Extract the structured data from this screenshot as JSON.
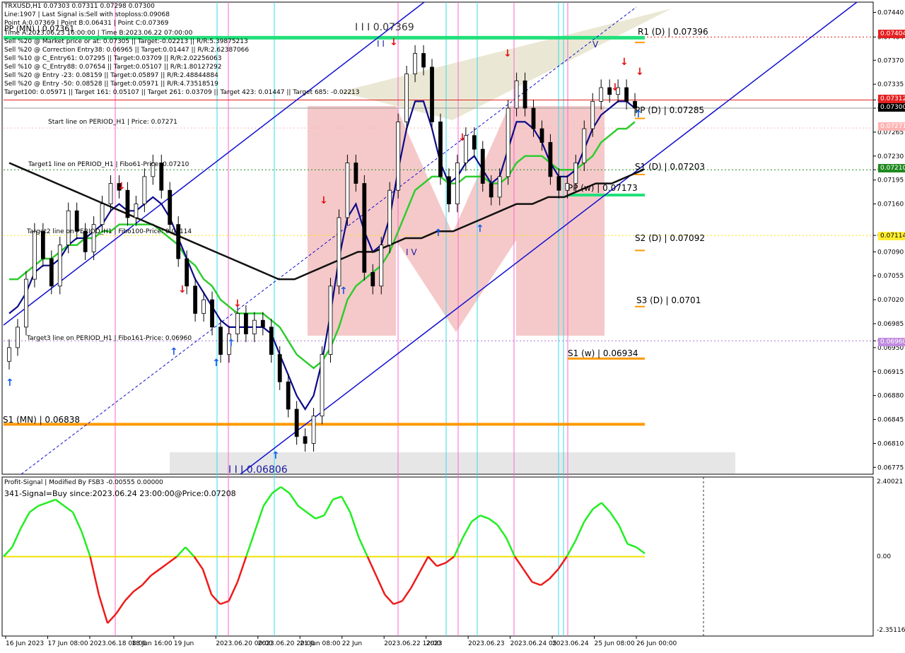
{
  "header": {
    "symbol_line": "TRXUSD,H1  0.07303 0.07311 0.07298 0.07300",
    "line_info": "Line:1907 | Last Signal is:Sell with stoploss:0.09068",
    "point_a": "Point A:0.07369 | Point B:0.06431 | Point C:0.07369",
    "time_a": "Time A:2023.06.23 16:00:00 | Time B:2023.06.22 07:00:00",
    "pp_overlay": "PP (MN) | 0.07361",
    "signals": [
      "Sell %20 @ Market price or at: 0.07305 || Target:-0.02213 || R/R:5.39875213",
      "Sell %20 @ Correction Entry38: 0.06965 || Target:0.01447 || R/R:2.62387066",
      "Sell %10 @ C_Entry61: 0.07295 || Target:0.03709 || R/R:2.02256063",
      "Sell %10 @ C_Entry88: 0.07654 || Target:0.05107 || R/R:1.80127292",
      "Sell %20 @ Entry -23: 0.08159 || Target:0.05897 || R/R:2.48844884",
      "Sell %20 @ Entry -50: 0.08528 || Target:0.05971 || R/R:4.73518519"
    ],
    "targets": "Target100: 0.05971 || Target 161: 0.05107 || Target 261: 0.03709 || Target 423: 0.01447 || Target 685: -0.02213"
  },
  "annotations": {
    "start_line": "Start line on PERIOD_H1 | Price: 0.07271",
    "target1": "Target1 line on PERIOD_H1 | Fibo61-Price: 0.07210",
    "target2": "Target2 line on PERIOD_H1 | Fibo100-Price: 0.07114",
    "target3": "Target3 line on PERIOD_H1 | Fibo161-Price: 0.06960",
    "top_wave": "I I I 0.07369",
    "bottom_wave": "I I I 0.06806",
    "wave_ii": "I I",
    "wave_iv": "I V",
    "wave_v": "V"
  },
  "levels": {
    "r1_d": "R1 (D) | 0.07396",
    "pp_d": "PP (D) | 0.07285",
    "s1_d": "S1 (D) | 0.07203",
    "pp_w": "PP (w) | 0.07173",
    "s2_d": "S2 (D) | 0.07092",
    "s3_d": "S3 (D) | 0.0701",
    "s1_w": "S1 (w) | 0.06934",
    "s1_mn": "S1 (MN) | 0.06838"
  },
  "price_axis": {
    "ticks": [
      "0.07440",
      "0.07404",
      "0.07370",
      "0.07335",
      "0.07312",
      "0.07300",
      "0.07265",
      "0.07230",
      "0.07210",
      "0.07195",
      "0.07160",
      "0.07114",
      "0.07090",
      "0.07055",
      "0.07020",
      "0.06985",
      "0.06960",
      "0.06950",
      "0.06915",
      "0.06880",
      "0.06845",
      "0.06810",
      "0.06775"
    ],
    "tag_red_top": "0.07404",
    "tag_red": "0.07312",
    "tag_black": "0.07300",
    "tag_pink": "0.07271",
    "tag_green": "0.07210",
    "tag_yellow": "0.07114",
    "tag_purple": "0.06960"
  },
  "time_axis": {
    "labels": [
      "16 Jun 2023",
      "17 Jun 08:00",
      "2023.06.18 08:00",
      "18 Jun 16:00",
      "19 Jun",
      "2023.06.20 00:00",
      "2023.06.20 20:00",
      "21 Jun 08:00",
      "22 Jun",
      "2023.06.22 12:00",
      "2023",
      "2023.06.23",
      "2023.06.24 05",
      "2023.06.24",
      "25 Jun 08:00",
      "26 Jun 00:00"
    ]
  },
  "indicator": {
    "title": "Profit-Signal | Modified By FSB3 -0.00555 0.00000",
    "signal": "341-Signal=Buy since:2023.06.24 23:00:00@Price:0.07208",
    "axis_top": "2.40021",
    "axis_zero": "0.00",
    "axis_bottom": "-2.35116"
  },
  "colors": {
    "bull": "#000000",
    "bear": "#000000",
    "ma_fast": "#0b0b8a",
    "ma_mid": "#2ecc2e",
    "ma_slow": "#111111",
    "channel": "#1010d0",
    "orange": "#ff9900",
    "green_level": "#22e07a",
    "pink": "#ff66cc",
    "cyan": "#33ddee"
  },
  "chart_data": {
    "type": "candlestick",
    "title": "TRXUSD,H1",
    "ylim": [
      0.06765,
      0.07455
    ],
    "close_series": [
      0.0695,
      0.0698,
      0.0705,
      0.0712,
      0.0708,
      0.0704,
      0.071,
      0.0715,
      0.0712,
      0.0709,
      0.0713,
      0.0716,
      0.0719,
      0.0718,
      0.0714,
      0.0716,
      0.072,
      0.0722,
      0.0718,
      0.0713,
      0.0708,
      0.0704,
      0.07,
      0.0702,
      0.0698,
      0.0694,
      0.0697,
      0.07,
      0.0697,
      0.0699,
      0.0698,
      0.0694,
      0.069,
      0.0686,
      0.0682,
      0.0681,
      0.0685,
      0.0694,
      0.0704,
      0.0714,
      0.0722,
      0.0719,
      0.0706,
      0.0704,
      0.071,
      0.0718,
      0.0728,
      0.0735,
      0.0738,
      0.0736,
      0.0728,
      0.072,
      0.0716,
      0.0722,
      0.0726,
      0.0724,
      0.0719,
      0.0717,
      0.072,
      0.073,
      0.0734,
      0.073,
      0.0727,
      0.0725,
      0.072,
      0.0718,
      0.0719,
      0.0722,
      0.0727,
      0.0731,
      0.0733,
      0.0732,
      0.0733,
      0.0731,
      0.073
    ],
    "ma_fast": [
      0.07,
      0.0701,
      0.0703,
      0.0706,
      0.0707,
      0.0707,
      0.0708,
      0.071,
      0.0711,
      0.0711,
      0.0712,
      0.0713,
      0.0715,
      0.0716,
      0.0715,
      0.0715,
      0.0716,
      0.0717,
      0.0716,
      0.0714,
      0.0711,
      0.0708,
      0.0705,
      0.0703,
      0.0701,
      0.0699,
      0.0698,
      0.0698,
      0.0698,
      0.0698,
      0.0698,
      0.0697,
      0.0694,
      0.0691,
      0.0688,
      0.0686,
      0.0688,
      0.0693,
      0.07,
      0.0708,
      0.0714,
      0.0716,
      0.0712,
      0.0709,
      0.071,
      0.0714,
      0.0721,
      0.0727,
      0.0731,
      0.0731,
      0.0727,
      0.0722,
      0.0719,
      0.072,
      0.0722,
      0.0723,
      0.0721,
      0.0719,
      0.072,
      0.0724,
      0.0728,
      0.0728,
      0.0727,
      0.0725,
      0.0722,
      0.072,
      0.072,
      0.0721,
      0.0724,
      0.0727,
      0.0729,
      0.073,
      0.0731,
      0.0731,
      0.073
    ],
    "ma_mid": [
      0.0705,
      0.0705,
      0.0706,
      0.0707,
      0.0708,
      0.0708,
      0.0709,
      0.071,
      0.071,
      0.0711,
      0.0711,
      0.0712,
      0.0712,
      0.0713,
      0.0713,
      0.0713,
      0.0713,
      0.0713,
      0.0712,
      0.0711,
      0.071,
      0.0708,
      0.0707,
      0.0705,
      0.0704,
      0.0702,
      0.0701,
      0.07,
      0.07,
      0.07,
      0.07,
      0.0699,
      0.0698,
      0.0696,
      0.0694,
      0.0693,
      0.0692,
      0.0693,
      0.0695,
      0.0698,
      0.0702,
      0.0704,
      0.0705,
      0.0706,
      0.0707,
      0.0709,
      0.0712,
      0.0715,
      0.0718,
      0.0719,
      0.072,
      0.072,
      0.0719,
      0.0719,
      0.072,
      0.072,
      0.072,
      0.0719,
      0.0719,
      0.072,
      0.0722,
      0.0723,
      0.0723,
      0.0723,
      0.0722,
      0.0721,
      0.0721,
      0.0721,
      0.0722,
      0.0723,
      0.0725,
      0.0726,
      0.0727,
      0.0727,
      0.0728
    ],
    "ma_slow": [
      0.0722,
      0.0721,
      0.072,
      0.0719,
      0.0718,
      0.0717,
      0.0716,
      0.0715,
      0.0714,
      0.0713,
      0.0712,
      0.0711,
      0.071,
      0.0709,
      0.0708,
      0.0707,
      0.0706,
      0.0705,
      0.0705,
      0.0706,
      0.0707,
      0.0708,
      0.0709,
      0.0709,
      0.071,
      0.0711,
      0.0711,
      0.0712,
      0.0712,
      0.0713,
      0.0714,
      0.0715,
      0.0716,
      0.0716,
      0.0717,
      0.0717,
      0.0718,
      0.0719,
      0.0719,
      0.072,
      0.0721
    ],
    "indicator_values": [
      0.0,
      0.3,
      0.9,
      1.4,
      1.6,
      1.7,
      1.8,
      1.6,
      1.4,
      0.8,
      0.0,
      -1.2,
      -2.1,
      -1.8,
      -1.4,
      -1.1,
      -0.9,
      -0.6,
      -0.4,
      -0.2,
      0.0,
      0.3,
      0.0,
      -0.4,
      -1.2,
      -1.5,
      -1.4,
      -0.8,
      0.0,
      0.8,
      1.6,
      2.0,
      2.2,
      2.0,
      1.6,
      1.4,
      1.2,
      1.3,
      1.8,
      1.9,
      1.4,
      0.6,
      0.0,
      -0.6,
      -1.2,
      -1.5,
      -1.4,
      -1.0,
      -0.5,
      0.0,
      -0.3,
      -0.2,
      0.0,
      0.6,
      1.1,
      1.3,
      1.2,
      1.0,
      0.6,
      0.0,
      -0.4,
      -0.8,
      -0.9,
      -0.7,
      -0.4,
      0.0,
      0.5,
      1.1,
      1.5,
      1.7,
      1.4,
      1.0,
      0.4,
      0.3,
      0.1
    ]
  }
}
